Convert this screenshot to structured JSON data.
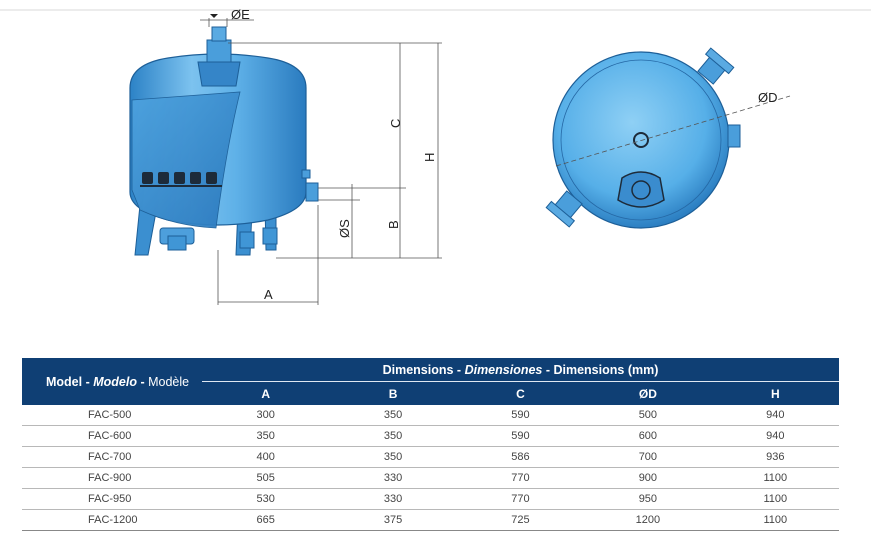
{
  "drawing": {
    "labels": {
      "E": "ØE",
      "C": "C",
      "H": "H",
      "S": "ØS",
      "B": "B",
      "A": "A",
      "D": "ØD"
    }
  },
  "table": {
    "model_header": {
      "en": "Model",
      "es": "Modelo",
      "fr": "Modèle",
      "sep": " - "
    },
    "dims_header": {
      "en": "Dimensions",
      "es": "Dimensiones",
      "fr": "Dimensions",
      "unit": "(mm)",
      "sep": " - "
    },
    "columns": [
      "A",
      "B",
      "C",
      "ØD",
      "H"
    ],
    "rows": [
      {
        "model": "FAC-500",
        "A": "300",
        "B": "350",
        "C": "590",
        "D": "500",
        "H": "940"
      },
      {
        "model": "FAC-600",
        "A": "350",
        "B": "350",
        "C": "590",
        "D": "600",
        "H": "940"
      },
      {
        "model": "FAC-700",
        "A": "400",
        "B": "350",
        "C": "586",
        "D": "700",
        "H": "936"
      },
      {
        "model": "FAC-900",
        "A": "505",
        "B": "330",
        "C": "770",
        "D": "900",
        "H": "1100"
      },
      {
        "model": "FAC-950",
        "A": "530",
        "B": "330",
        "C": "770",
        "D": "950",
        "H": "1100"
      },
      {
        "model": "FAC-1200",
        "A": "665",
        "B": "375",
        "C": "725",
        "D": "1200",
        "H": "1100"
      }
    ]
  },
  "colors": {
    "tank_light": "#8ccaf0",
    "tank_mid": "#4aa6e2",
    "tank_dark": "#1f73b8",
    "header_bg": "#0f3f74"
  }
}
